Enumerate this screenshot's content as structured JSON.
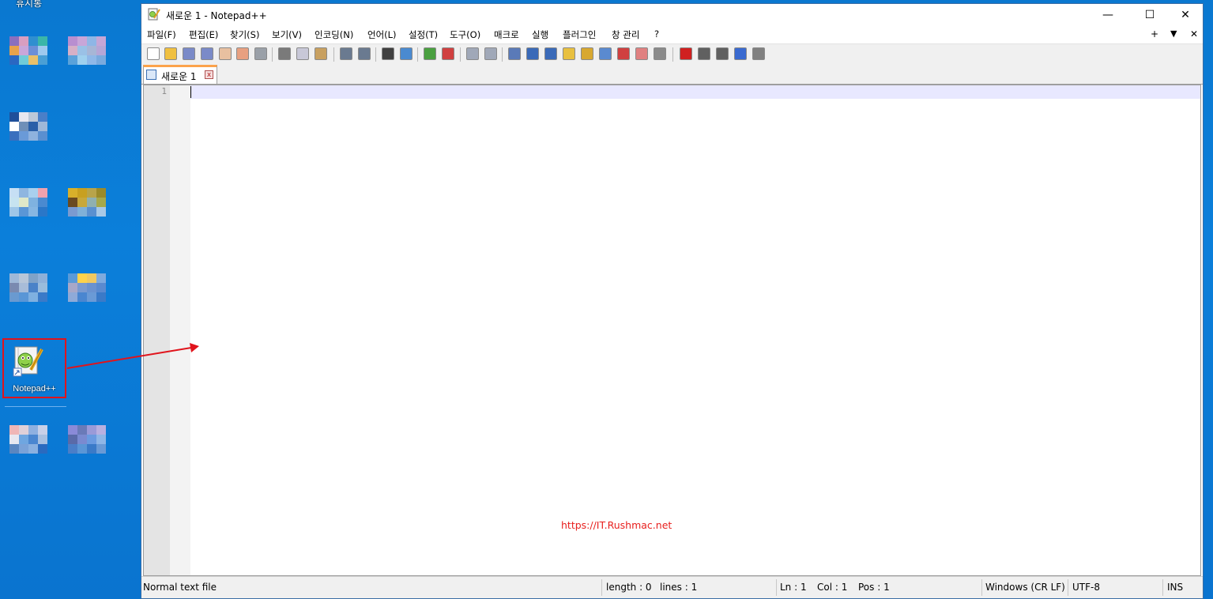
{
  "desktop": {
    "top_label": "휴지통",
    "shortcut_label": "Notepad++",
    "blurred_icons": [
      {
        "colors": [
          "#8a6fbf",
          "#d99ec0",
          "#2f8fd0",
          "#3bb6a8",
          "#e8a24a",
          "#c9a6d9",
          "#6b8fd8",
          "#9fc9ee",
          "#2a67c2",
          "#6fcbd8",
          "#e8c06a",
          "#4a9fd5"
        ]
      },
      {
        "colors": [
          "#b88fd0",
          "#c8a6d8",
          "#8fb6e6",
          "#c6a6d6",
          "#d6b0c6",
          "#9ac1e6",
          "#a7b6d6",
          "#b6a6d6",
          "#5aa2da",
          "#9fd0ee",
          "#8fb8e8",
          "#7aaade"
        ]
      },
      {
        "colors": [
          "#1f4f9a",
          "#e8e8f0",
          "#bcc8d8",
          "#4a7fc8",
          "#ffffff",
          "#6f8fb8",
          "#2a5fa8",
          "#9fb8d8",
          "#3a6fbe",
          "#6a9ad8",
          "#8fb2de",
          "#5a8fd0"
        ]
      },
      {
        "colors": [
          "#c6dff4",
          "#8fb6e0",
          "#a9d0ee",
          "#f0a2ae",
          "#c6e3f0",
          "#dfe8c8",
          "#7fb2e0",
          "#4a8ad0",
          "#9ec6e8",
          "#5a96d6",
          "#86b6e2",
          "#2a77c8"
        ]
      },
      {
        "colors": [
          "#d8b02a",
          "#c8a020",
          "#b8a44a",
          "#9a8a2a",
          "#6a4a20",
          "#c8a83a",
          "#8fb0b0",
          "#a6a84a",
          "#7a9ad0",
          "#7fb0d8",
          "#5a90d0",
          "#a8c8e6"
        ]
      },
      {
        "colors": [
          "#9fb8d8",
          "#b8c6d8",
          "#7fa2c8",
          "#8fb0d8",
          "#7a8ab0",
          "#a8bcd8",
          "#4a82c8",
          "#9abcdc",
          "#6a9ad0",
          "#5a96d6",
          "#7fb0e0",
          "#3a7ac8"
        ]
      },
      {
        "colors": [
          "#5a9ad8",
          "#ffd24a",
          "#f0c860",
          "#7faade",
          "#a8a8c8",
          "#7a9ad0",
          "#6a92d0",
          "#5a8ad0",
          "#8faad8",
          "#4a86d0",
          "#6a9ad6",
          "#3a7ac8"
        ]
      },
      {
        "colors": [
          "#f0b6b6",
          "#e0d0d8",
          "#8fb0e0",
          "#c8d0e8",
          "#e8e8f0",
          "#6fa6e0",
          "#4a86d0",
          "#a8c0e0",
          "#5a86c0",
          "#7aa2d8",
          "#8ab0e0",
          "#2a6abf"
        ]
      },
      {
        "colors": [
          "#8a8ad8",
          "#6a7ab8",
          "#9a9ad8",
          "#b8b0e0",
          "#5a6aa8",
          "#7a8ad0",
          "#6a9ae0",
          "#8fb6e6",
          "#4a7ec8",
          "#5a96d6",
          "#3a7ac8",
          "#6a9ad6"
        ]
      }
    ]
  },
  "window": {
    "title": "새로운 1 - Notepad++",
    "minimize_glyph": "—",
    "maximize_glyph": "☐",
    "close_glyph": "✕",
    "menus": [
      "파일(F)",
      "편집(E)",
      "찾기(S)",
      "보기(V)",
      "인코딩(N)",
      "언어(L)",
      "설정(T)",
      "도구(O)",
      "매크로",
      "실행",
      "플러그인",
      "창 관리",
      "?"
    ],
    "menu_right": {
      "plus": "+",
      "dropdown": "▼",
      "close": "✕"
    },
    "toolbar": [
      {
        "name": "new-file-icon",
        "color": "#ffffff"
      },
      {
        "name": "open-file-icon",
        "color": "#f0c040"
      },
      {
        "name": "save-icon",
        "color": "#7a8ac8"
      },
      {
        "name": "save-all-icon",
        "color": "#7a8ac8"
      },
      {
        "name": "close-icon",
        "color": "#e8c0a0"
      },
      {
        "name": "close-all-icon",
        "color": "#e8a080"
      },
      {
        "name": "print-icon",
        "color": "#9aa0a8"
      },
      {
        "name": "cut-icon",
        "color": "#7a7a7a"
      },
      {
        "name": "copy-icon",
        "color": "#c8c8d8"
      },
      {
        "name": "paste-icon",
        "color": "#c8a060"
      },
      {
        "name": "undo-icon",
        "color": "#6a7a90"
      },
      {
        "name": "redo-icon",
        "color": "#6a7a90"
      },
      {
        "name": "find-icon",
        "color": "#404040"
      },
      {
        "name": "replace-icon",
        "color": "#4a8ad0"
      },
      {
        "name": "zoom-in-icon",
        "color": "#4aa040"
      },
      {
        "name": "zoom-out-icon",
        "color": "#d04040"
      },
      {
        "name": "sync-vertical-icon",
        "color": "#a0a8b8"
      },
      {
        "name": "sync-horizontal-icon",
        "color": "#a0a8b8"
      },
      {
        "name": "word-wrap-icon",
        "color": "#5a7ab8"
      },
      {
        "name": "show-all-chars-icon",
        "color": "#3a6ab8"
      },
      {
        "name": "indent-guide-icon",
        "color": "#3a6ab8"
      },
      {
        "name": "udl-icon",
        "color": "#e8c040"
      },
      {
        "name": "doc-map-icon",
        "color": "#d8a830"
      },
      {
        "name": "doc-list-icon",
        "color": "#5a8ad0"
      },
      {
        "name": "function-list-icon",
        "color": "#d04040"
      },
      {
        "name": "folder-workspace-icon",
        "color": "#e08080"
      },
      {
        "name": "monitoring-icon",
        "color": "#8a8a8a"
      },
      {
        "name": "record-macro-icon",
        "color": "#d02020"
      },
      {
        "name": "stop-record-icon",
        "color": "#606060"
      },
      {
        "name": "play-macro-icon",
        "color": "#606060"
      },
      {
        "name": "run-macro-multiple-icon",
        "color": "#3a6ad0"
      },
      {
        "name": "save-macro-icon",
        "color": "#808080"
      }
    ],
    "tab": {
      "label": "새로운 1",
      "close_glyph": "x"
    },
    "editor": {
      "line_number": "1",
      "watermark": "https://IT.Rushmac.net"
    },
    "status": {
      "file_type": "Normal text file",
      "length": "length : 0",
      "lines": "lines : 1",
      "ln": "Ln : 1",
      "col": "Col : 1",
      "pos": "Pos : 1",
      "eol": "Windows (CR LF)",
      "encoding": "UTF-8",
      "mode": "INS"
    }
  }
}
